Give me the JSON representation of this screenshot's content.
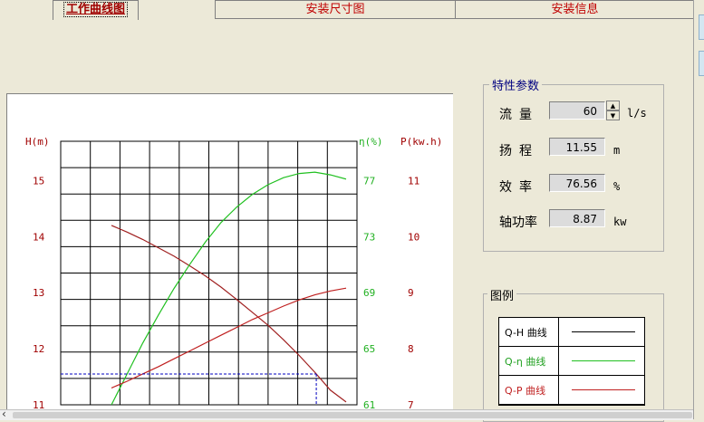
{
  "tabs": [
    {
      "label": "工作曲线图",
      "active": true
    },
    {
      "label": "安装尺寸图",
      "active": false
    },
    {
      "label": "安装信息",
      "active": false
    }
  ],
  "chart_data": {
    "type": "line",
    "axis_labels": {
      "left": "H(m)",
      "eta": "η(%)",
      "power": "P(kw.h)"
    },
    "h_ticks": [
      "15",
      "14",
      "13",
      "12",
      "11"
    ],
    "eta_ticks": [
      "77",
      "73",
      "69",
      "65",
      "61"
    ],
    "p_ticks": [
      "11",
      "10",
      "9",
      "8",
      "7"
    ],
    "h_range": [
      11,
      15.7
    ],
    "eta_range": [
      61,
      79.8
    ],
    "p_range": [
      7,
      11.7
    ],
    "grid": true,
    "series": [
      {
        "name": "Q-H 曲线",
        "color": "#a02020",
        "axis": "h",
        "values": [
          14.2,
          14.08,
          13.95,
          13.8,
          13.65,
          13.48,
          13.3,
          13.1,
          12.88,
          12.65,
          12.42,
          12.16,
          11.88,
          11.58,
          11.26,
          11.05
        ]
      },
      {
        "name": "Q-η 曲线",
        "color": "#20c020",
        "axis": "eta",
        "values": [
          61,
          63.2,
          65.4,
          67.4,
          69.3,
          71.0,
          72.6,
          74.0,
          75.1,
          76.0,
          76.7,
          77.2,
          77.5,
          77.6,
          77.4,
          77.1
        ]
      },
      {
        "name": "Q-P 曲线",
        "color": "#c02020",
        "axis": "p",
        "values": [
          7.3,
          7.42,
          7.55,
          7.68,
          7.82,
          7.96,
          8.1,
          8.24,
          8.38,
          8.52,
          8.64,
          8.76,
          8.87,
          8.96,
          9.03,
          9.08
        ]
      }
    ],
    "operating_point": {
      "h": 11.55
    }
  },
  "params": {
    "title": "特性参数",
    "flow": {
      "label": "流量",
      "value": "60",
      "unit": "l/s"
    },
    "head": {
      "label": "扬程",
      "value": "11.55",
      "unit": "m"
    },
    "eff": {
      "label": "效率",
      "value": "76.56",
      "unit": "%"
    },
    "power": {
      "label": "轴功率",
      "value": "8.87",
      "unit": "kw"
    }
  },
  "legend": {
    "title": "图例",
    "rows": [
      {
        "label": "Q-H 曲线",
        "color": "#000000"
      },
      {
        "label": "Q-η 曲线",
        "color": "#20c020"
      },
      {
        "label": "Q-P 曲线",
        "color": "#c02020"
      }
    ]
  }
}
